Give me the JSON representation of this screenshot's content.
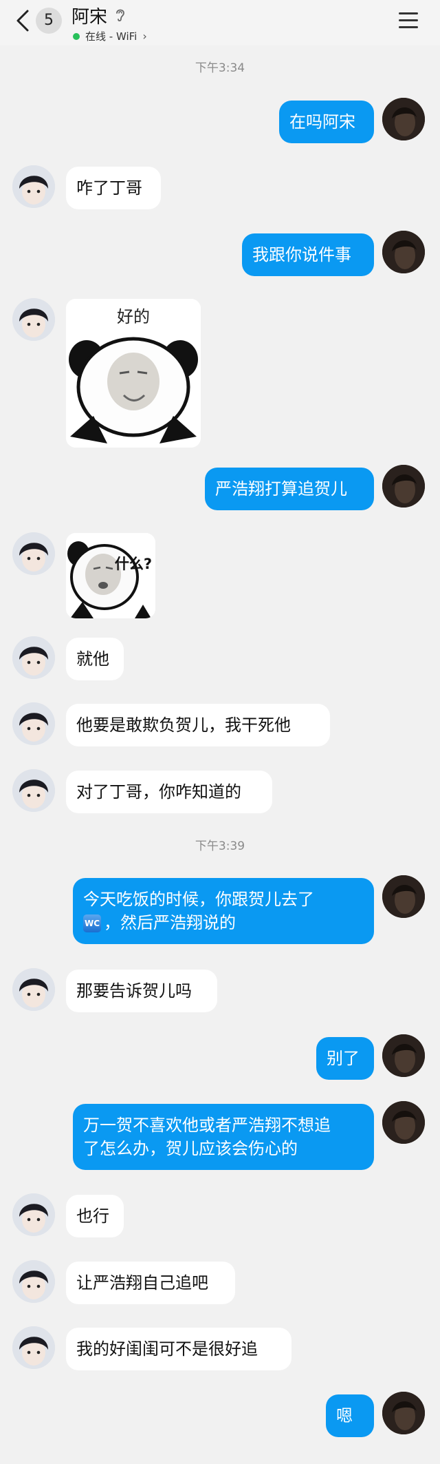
{
  "header": {
    "unread_count": "5",
    "contact_name": "阿宋",
    "status_text": "在线 - WiFi",
    "online_color": "#27c05a"
  },
  "timestamps": [
    "下午3:34",
    "下午3:39"
  ],
  "messages": [
    {
      "side": "right",
      "text": "在吗阿宋"
    },
    {
      "side": "left",
      "text": "咋了丁哥"
    },
    {
      "side": "right",
      "text": "我跟你说件事"
    },
    {
      "side": "left",
      "type": "sticker",
      "caption": "好的"
    },
    {
      "side": "right",
      "text": "严浩翔打算追贺儿"
    },
    {
      "side": "left",
      "type": "sticker",
      "caption": "什么?"
    },
    {
      "side": "left",
      "text": "就他"
    },
    {
      "side": "left",
      "text": "他要是敢欺负贺儿，我干死他"
    },
    {
      "side": "left",
      "text": "对了丁哥，你咋知道的"
    },
    {
      "side": "right",
      "text_line1": "今天吃饭的时候，你跟贺儿去了",
      "emoji_label": "WC",
      "text_line2": "，然后严浩翔说的"
    },
    {
      "side": "left",
      "text": "那要告诉贺儿吗"
    },
    {
      "side": "right",
      "text": "别了"
    },
    {
      "side": "right",
      "text_line1": "万一贺不喜欢他或者严浩翔不想追",
      "text_line2": "了怎么办，贺儿应该会伤心的"
    },
    {
      "side": "left",
      "text": "也行"
    },
    {
      "side": "left",
      "text": "让严浩翔自己追吧"
    },
    {
      "side": "left",
      "text": "我的好闺闺可不是很好追"
    },
    {
      "side": "right",
      "text": "嗯"
    }
  ],
  "colors": {
    "self_bubble": "#0a99f2",
    "other_bubble": "#ffffff",
    "background": "#f1f1f1"
  }
}
